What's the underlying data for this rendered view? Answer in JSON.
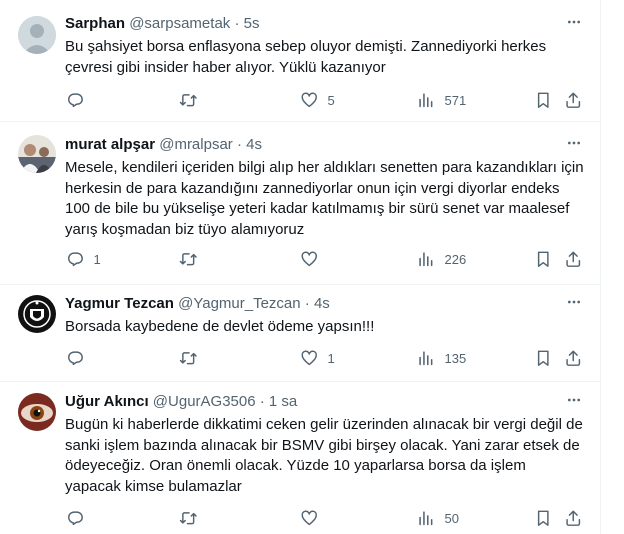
{
  "colors": {
    "text": "#0f1419",
    "secondary": "#536471",
    "divider": "#eff3f4"
  },
  "icons": {
    "reply": "reply-icon",
    "retweet": "retweet-icon",
    "like": "heart-icon",
    "views": "views-icon",
    "bookmark": "bookmark-icon",
    "share": "share-icon",
    "more": "more-icon"
  },
  "tweets": [
    {
      "name": "Sarphan",
      "handle": "@sarpsametak",
      "sep": "·",
      "time": "5s",
      "text": "Bu şahsiyet borsa enflasyona sebep oluyor demişti. Zannediyorki herkes çevresi gibi insider haber alıyor. Yüklü kazanıyor",
      "replies": "",
      "retweets": "",
      "likes": "5",
      "views": "571"
    },
    {
      "name": "murat alpşar",
      "handle": "@mralpsar",
      "sep": "·",
      "time": "4s",
      "text": "Mesele, kendileri içeriden bilgi alıp her aldıkları senetten para kazandıkları için herkesin de para kazandığını zannediyorlar onun için vergi diyorlar endeks 100 de bile bu yükselişe yeteri kadar katılmamış bir sürü senet var maalesef yarış koşmadan biz tüyo alamıyoruz",
      "replies": "1",
      "retweets": "",
      "likes": "",
      "views": "226"
    },
    {
      "name": "Yagmur Tezcan",
      "handle": "@Yagmur_Tezcan",
      "sep": "·",
      "time": "4s",
      "text": "Borsada kaybedene de devlet ödeme yapsın!!!",
      "replies": "",
      "retweets": "",
      "likes": "1",
      "views": "135"
    },
    {
      "name": "Uğur Akıncı",
      "handle": "@UgurAG3506",
      "sep": "·",
      "time": "1 sa",
      "text": "Bugün ki haberlerde dikkatimi ceken gelir üzerinden alınacak bir vergi değil de sanki işlem bazında alınacak bir BSMV gibi birşey olacak. Yani zarar etsek de ödeyeceğiz. Oran önemli olacak. Yüzde 10 yaparlarsa borsa da işlem yapacak kimse bulamazlar",
      "replies": "",
      "retweets": "",
      "likes": "",
      "views": "50"
    }
  ]
}
